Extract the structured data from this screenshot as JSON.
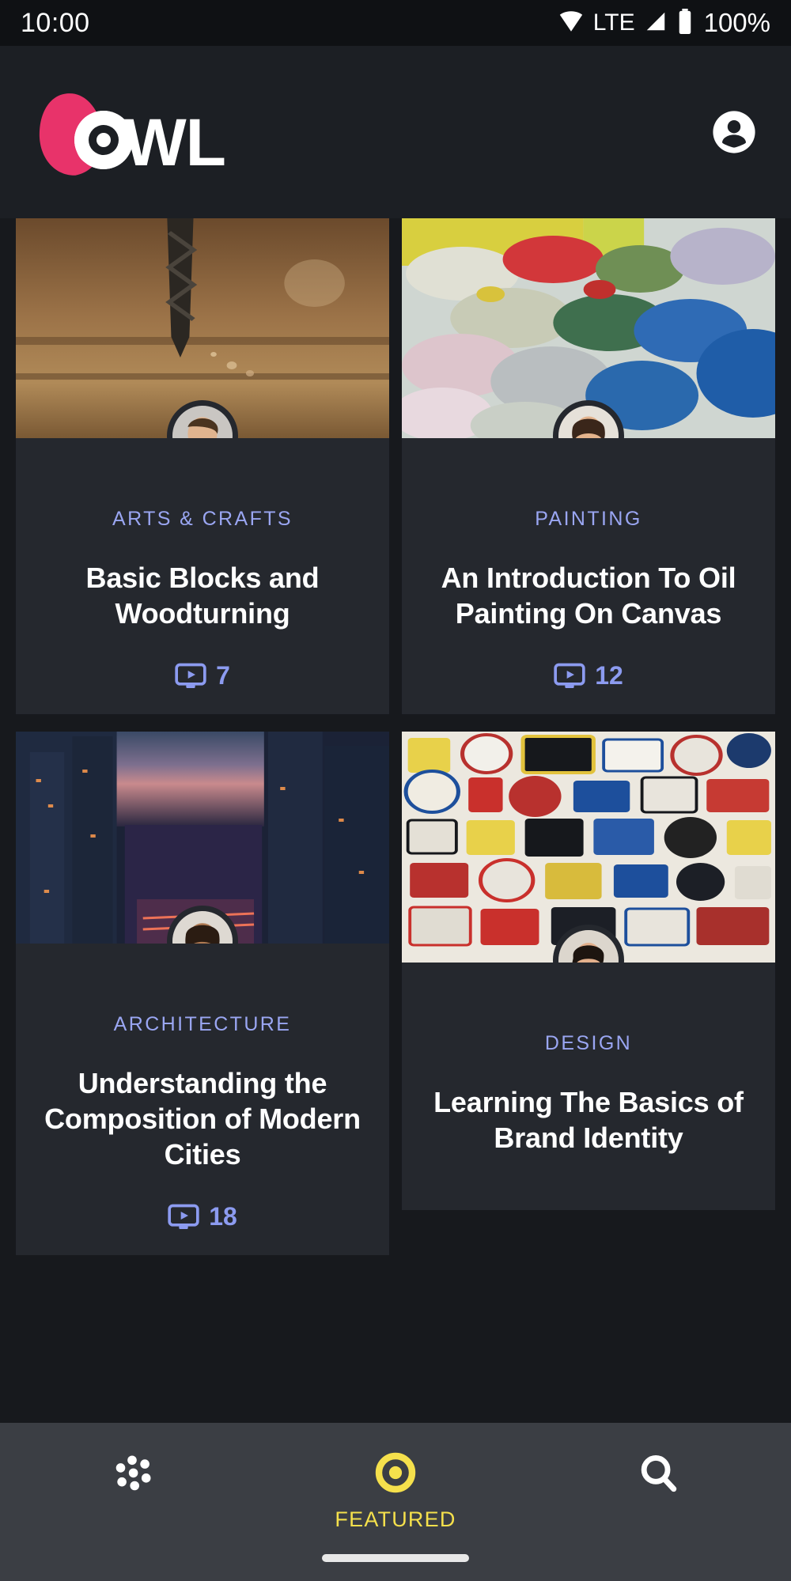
{
  "statusbar": {
    "time": "10:00",
    "network": "LTE",
    "battery": "100%",
    "wifi_icon": "wifi-icon",
    "signal_icon": "signal-icon",
    "battery_icon": "battery-icon"
  },
  "header": {
    "brand": "OWL",
    "brand_colors": {
      "bird": "#E8336A",
      "beak": "#F5D54A",
      "word": "#FFFFFF"
    },
    "account_icon": "account-circle-icon"
  },
  "theme": {
    "page_bg": "#17191d",
    "card_bg": "#25282e",
    "category_color": "#9aa6f2",
    "accent_yellow": "#F5E04C",
    "title_color": "#FFFFFF",
    "navbar_bg": "#3B3E44"
  },
  "cards": [
    {
      "category": "ARTS & CRAFTS",
      "title": "Basic Blocks and Woodturning",
      "video_count": "7",
      "video_icon": "video-monitor-icon",
      "thumbnail_alt": "drill-bit-on-wood",
      "avatar_alt": "author-avatar-young-man"
    },
    {
      "category": "PAINTING",
      "title": "An Introduction To Oil Painting On Canvas",
      "video_count": "12",
      "video_icon": "video-monitor-icon",
      "thumbnail_alt": "paint-palette-colors",
      "avatar_alt": "author-avatar-woman"
    },
    {
      "category": "ARCHITECTURE",
      "title": "Understanding the Composition of Modern Cities",
      "video_count": "18",
      "video_icon": "video-monitor-icon",
      "thumbnail_alt": "city-skyline-at-dusk",
      "avatar_alt": "author-avatar-smiling-woman"
    },
    {
      "category": "DESIGN",
      "title": "Learning The Basics of Brand Identity",
      "video_count": "",
      "video_icon": "video-monitor-icon",
      "thumbnail_alt": "embroidered-patches-collection",
      "avatar_alt": "author-avatar-short-hair-woman"
    }
  ],
  "bottomnav": {
    "items": [
      {
        "id": "browse",
        "icon": "dots-grid-icon",
        "label": "",
        "active": false
      },
      {
        "id": "featured",
        "icon": "eye-target-icon",
        "label": "FEATURED",
        "active": true
      },
      {
        "id": "search",
        "icon": "search-icon",
        "label": "",
        "active": false
      }
    ]
  }
}
